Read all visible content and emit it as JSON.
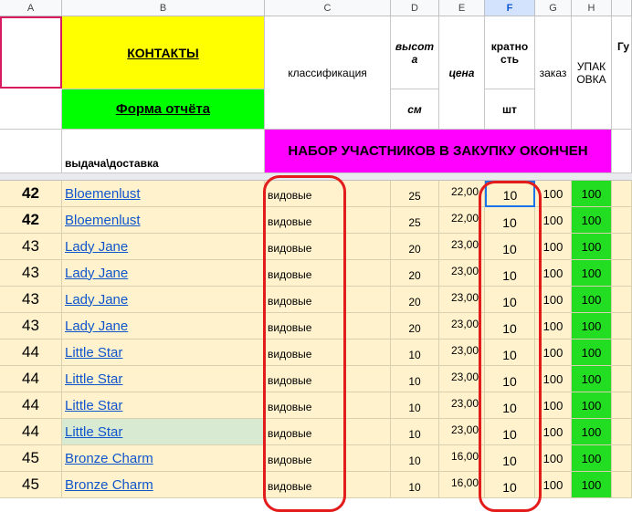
{
  "columns": [
    "A",
    "B",
    "C",
    "D",
    "E",
    "F",
    "G",
    "H"
  ],
  "header": {
    "contacts": "КОНТАКТЫ",
    "report_form": "Форма отчёта",
    "delivery": "выдача\\доставка",
    "classification": "классификация",
    "height_top": "высота",
    "height_unit": "см",
    "price": "цена",
    "multiplicity": "кратность",
    "multiplicity_unit": "шт",
    "order": "заказ",
    "packing": "УПАКОВКА",
    "extra": "Гу",
    "banner": "НАБОР УЧАСТНИКОВ В ЗАКУПКУ ОКОНЧЕН"
  },
  "rows": [
    {
      "a": "42",
      "name": "Bloemenlust",
      "cls": "видовые",
      "h": "25",
      "price": "22,00",
      "mult": "10",
      "order": "100",
      "pack": "100",
      "bold": true
    },
    {
      "a": "42",
      "name": "Bloemenlust",
      "cls": "видовые",
      "h": "25",
      "price": "22,00",
      "mult": "10",
      "order": "100",
      "pack": "100",
      "bold": true
    },
    {
      "a": "43",
      "name": "Lady Jane",
      "cls": "видовые",
      "h": "20",
      "price": "23,00",
      "mult": "10",
      "order": "100",
      "pack": "100",
      "bold": false
    },
    {
      "a": "43",
      "name": "Lady Jane",
      "cls": "видовые",
      "h": "20",
      "price": "23,00",
      "mult": "10",
      "order": "100",
      "pack": "100",
      "bold": false
    },
    {
      "a": "43",
      "name": "Lady Jane",
      "cls": "видовые",
      "h": "20",
      "price": "23,00",
      "mult": "10",
      "order": "100",
      "pack": "100",
      "bold": false
    },
    {
      "a": "43",
      "name": "Lady Jane",
      "cls": "видовые",
      "h": "20",
      "price": "23,00",
      "mult": "10",
      "order": "100",
      "pack": "100",
      "bold": false
    },
    {
      "a": "44",
      "name": "Little Star",
      "cls": "видовые",
      "h": "10",
      "price": "23,00",
      "mult": "10",
      "order": "100",
      "pack": "100",
      "bold": false
    },
    {
      "a": "44",
      "name": "Little Star",
      "cls": "видовые",
      "h": "10",
      "price": "23,00",
      "mult": "10",
      "order": "100",
      "pack": "100",
      "bold": false
    },
    {
      "a": "44",
      "name": "Little Star",
      "cls": "видовые",
      "h": "10",
      "price": "23,00",
      "mult": "10",
      "order": "100",
      "pack": "100",
      "bold": false
    },
    {
      "a": "44",
      "name": "Little Star",
      "cls": "видовые",
      "h": "10",
      "price": "23,00",
      "mult": "10",
      "order": "100",
      "pack": "100",
      "bold": false
    },
    {
      "a": "45",
      "name": "Bronze Charm",
      "cls": "видовые",
      "h": "10",
      "price": "16,00",
      "mult": "10",
      "order": "100",
      "pack": "100",
      "bold": false
    },
    {
      "a": "45",
      "name": "Bronze Charm",
      "cls": "видовые",
      "h": "10",
      "price": "16,00",
      "mult": "10",
      "order": "100",
      "pack": "100",
      "bold": false
    }
  ],
  "colors": {
    "yellow": "#ffff00",
    "green": "#00ff00",
    "magenta": "#ff00ff",
    "row_bg": "#fff2cc",
    "pack_green": "#22dd22",
    "oval_red": "#e31b1b"
  }
}
